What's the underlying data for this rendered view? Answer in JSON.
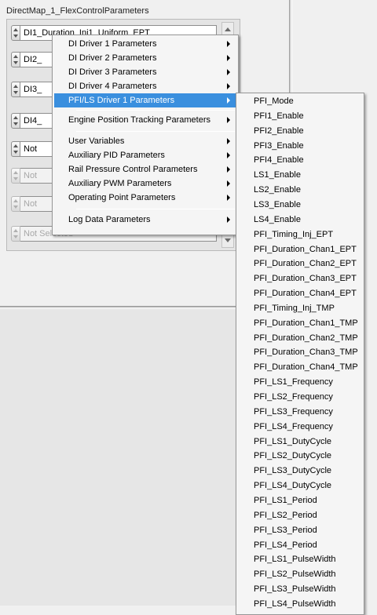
{
  "panel": {
    "title": "DirectMap_1_FlexControlParameters",
    "rows": [
      {
        "text": "DI1_Duration_Inj1_Uniform_EPT",
        "disabled": false
      },
      {
        "text": "DI2_",
        "disabled": false
      },
      {
        "text": "DI3_",
        "disabled": false
      },
      {
        "text": "DI4_",
        "disabled": false
      },
      {
        "text": "Not",
        "disabled": false
      },
      {
        "text": "Not",
        "disabled": true
      },
      {
        "text": "Not",
        "disabled": true
      },
      {
        "text": "Not Selected",
        "disabled": true
      }
    ]
  },
  "context_menu": {
    "items": [
      {
        "label": "DI Driver 1 Parameters",
        "submenu": true
      },
      {
        "label": "DI Driver 2 Parameters",
        "submenu": true
      },
      {
        "label": "DI Driver 3 Parameters",
        "submenu": true
      },
      {
        "label": "DI Driver 4 Parameters",
        "submenu": true
      },
      {
        "label": "PFI/LS Driver 1 Parameters",
        "submenu": true,
        "highlighted": true
      },
      {
        "label": "Engine Position Tracking Parameters",
        "submenu": true
      },
      {
        "label": "User Variables",
        "submenu": true
      },
      {
        "label": "Auxiliary PID Parameters",
        "submenu": true
      },
      {
        "label": "Rail Pressure Control Parameters",
        "submenu": true
      },
      {
        "label": "Auxiliary PWM Parameters",
        "submenu": true
      },
      {
        "label": "Operating Point Parameters",
        "submenu": true
      },
      {
        "label": "Log Data Parameters",
        "submenu": true
      }
    ]
  },
  "submenu": {
    "items": [
      "PFI_Mode",
      "PFI1_Enable",
      "PFI2_Enable",
      "PFI3_Enable",
      "PFI4_Enable",
      "LS1_Enable",
      "LS2_Enable",
      "LS3_Enable",
      "LS4_Enable",
      "PFI_Timing_Inj_EPT",
      "PFI_Duration_Chan1_EPT",
      "PFI_Duration_Chan2_EPT",
      "PFI_Duration_Chan3_EPT",
      "PFI_Duration_Chan4_EPT",
      "PFI_Timing_Inj_TMP",
      "PFI_Duration_Chan1_TMP",
      "PFI_Duration_Chan2_TMP",
      "PFI_Duration_Chan3_TMP",
      "PFI_Duration_Chan4_TMP",
      "PFI_LS1_Frequency",
      "PFI_LS2_Frequency",
      "PFI_LS3_Frequency",
      "PFI_LS4_Frequency",
      "PFI_LS1_DutyCycle",
      "PFI_LS2_DutyCycle",
      "PFI_LS3_DutyCycle",
      "PFI_LS4_DutyCycle",
      "PFI_LS1_Period",
      "PFI_LS2_Period",
      "PFI_LS3_Period",
      "PFI_LS4_Period",
      "PFI_LS1_PulseWidth",
      "PFI_LS2_PulseWidth",
      "PFI_LS3_PulseWidth",
      "PFI_LS4_PulseWidth"
    ]
  },
  "colors": {
    "highlight": "#3a8fde",
    "menu_bg": "#f5f5f5",
    "panel_bg": "#f0f0f0"
  }
}
